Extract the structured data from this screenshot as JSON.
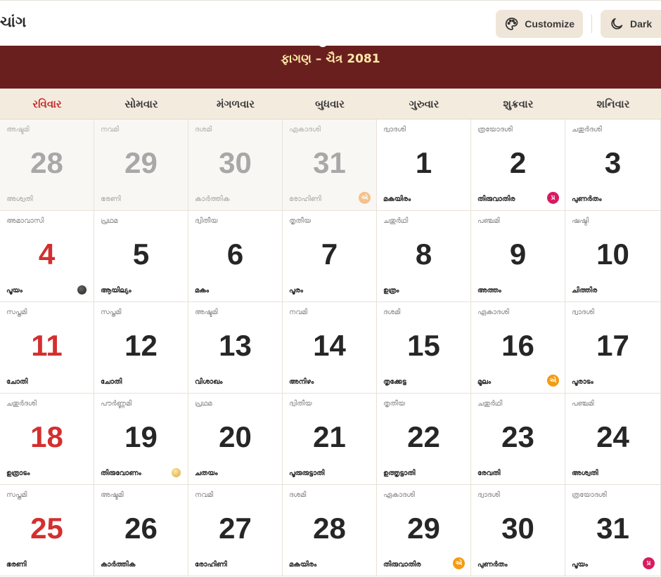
{
  "header": {
    "app_title": "ચાંગ",
    "customize_label": "Customize",
    "dark_label": "Dark"
  },
  "month": {
    "title": "ફાગણ – ચૈત્ર 2081"
  },
  "weekdays": [
    "રવિવાર",
    "સોમવાર",
    "મંગળવાર",
    "બુધવાર",
    "ગુરુવાર",
    "શુક્રવાર",
    "શનિવાર"
  ],
  "days": [
    {
      "num": "28",
      "tithi": "അഷ്ടമി",
      "nakshatra": "അശ്വതി",
      "prev": true
    },
    {
      "num": "29",
      "tithi": "നവമി",
      "nakshatra": "ഭരണി",
      "prev": true
    },
    {
      "num": "30",
      "tithi": "ദശമി",
      "nakshatra": "കാർത്തിക",
      "prev": true
    },
    {
      "num": "31",
      "tithi": "ഏകാദശി",
      "nakshatra": "രോഹിണി",
      "prev": true,
      "badge": "એ",
      "badge_color": "peach"
    },
    {
      "num": "1",
      "tithi": "ദ്വാദശി",
      "nakshatra": "മകയിരം"
    },
    {
      "num": "2",
      "tithi": "ത്രയോദശി",
      "nakshatra": "തിരുവാതിര",
      "badge": "પ્ર",
      "badge_color": "pink"
    },
    {
      "num": "3",
      "tithi": "ചതുർദശി",
      "nakshatra": "പുണർതം"
    },
    {
      "num": "4",
      "tithi": "അമാവാസി",
      "nakshatra": "പൂയം",
      "moon": "new"
    },
    {
      "num": "5",
      "tithi": "പ്രഥമ",
      "nakshatra": "ആയില്യം"
    },
    {
      "num": "6",
      "tithi": "ദ്വിതീയ",
      "nakshatra": "മകം"
    },
    {
      "num": "7",
      "tithi": "തൃതീയ",
      "nakshatra": "പൂരം"
    },
    {
      "num": "8",
      "tithi": "ചതുർഥി",
      "nakshatra": "ഉത്രം"
    },
    {
      "num": "9",
      "tithi": "പഞ്ചമി",
      "nakshatra": "അത്തം"
    },
    {
      "num": "10",
      "tithi": "ഷഷ്ഠി",
      "nakshatra": "ചിത്തിര"
    },
    {
      "num": "11",
      "tithi": "സപ്തമി",
      "nakshatra": "ചോതി"
    },
    {
      "num": "12",
      "tithi": "സപ്തമി",
      "nakshatra": "ചോതി"
    },
    {
      "num": "13",
      "tithi": "അഷ്ടമി",
      "nakshatra": "വിശാഖം"
    },
    {
      "num": "14",
      "tithi": "നവമി",
      "nakshatra": "അനിഴം"
    },
    {
      "num": "15",
      "tithi": "ദശമി",
      "nakshatra": "തൃക്കേട്ട"
    },
    {
      "num": "16",
      "tithi": "ഏകാദശി",
      "nakshatra": "മൂലം",
      "badge": "એ",
      "badge_color": "orange"
    },
    {
      "num": "17",
      "tithi": "ദ്വാദശി",
      "nakshatra": "പൂരാടം"
    },
    {
      "num": "18",
      "tithi": "ചതുർദശി",
      "nakshatra": "ഉത്രാടം"
    },
    {
      "num": "19",
      "tithi": "പൗർണ്ണമി",
      "nakshatra": "തിരുവോണം",
      "moon": "full"
    },
    {
      "num": "20",
      "tithi": "പ്രഥമ",
      "nakshatra": "ചതയം"
    },
    {
      "num": "21",
      "tithi": "ദ്വിതീയ",
      "nakshatra": "പൂരുരുട്ടാതി"
    },
    {
      "num": "22",
      "tithi": "തൃതീയ",
      "nakshatra": "ഉത്തൃട്ടാതി"
    },
    {
      "num": "23",
      "tithi": "ചതുർഥി",
      "nakshatra": "രേവതി"
    },
    {
      "num": "24",
      "tithi": "പഞ്ചമി",
      "nakshatra": "അശ്വതി"
    },
    {
      "num": "25",
      "tithi": "സപ്തമി",
      "nakshatra": "ഭരണി"
    },
    {
      "num": "26",
      "tithi": "അഷ്ടമി",
      "nakshatra": "കാർത്തിക"
    },
    {
      "num": "27",
      "tithi": "നവമി",
      "nakshatra": "രോഹിണി"
    },
    {
      "num": "28",
      "tithi": "ദശമി",
      "nakshatra": "മകയിരം"
    },
    {
      "num": "29",
      "tithi": "ഏകാദശി",
      "nakshatra": "തിരുവാതിര",
      "badge": "એ",
      "badge_color": "orange"
    },
    {
      "num": "30",
      "tithi": "ദ്വാദശി",
      "nakshatra": "പുണർതം"
    },
    {
      "num": "31",
      "tithi": "ത്രയോദശി",
      "nakshatra": "പൂയം",
      "badge": "પ્ર",
      "badge_color": "pink"
    }
  ]
}
